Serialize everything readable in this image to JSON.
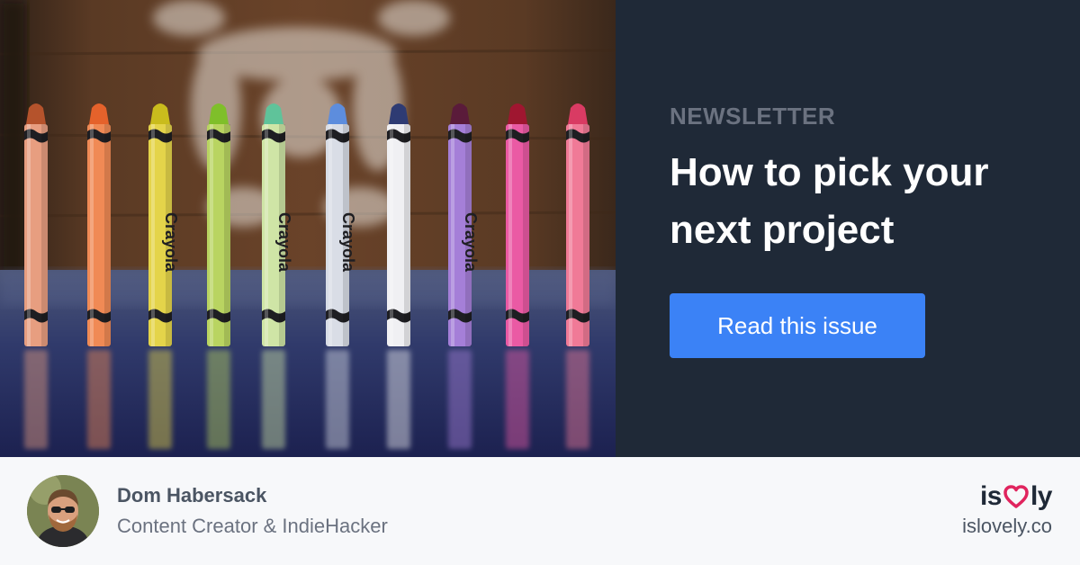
{
  "hero": {
    "eyebrow": "NEWSLETTER",
    "headline": "How to pick your next project",
    "cta_label": "Read this issue",
    "crayon_print": "Crayola"
  },
  "author": {
    "name": "Dom Habersack",
    "role": "Content Creator & IndieHacker"
  },
  "brand": {
    "logo_left": "is",
    "logo_right": "ly",
    "url": "islovely.co"
  },
  "colors": {
    "panel_bg": "#1f2937",
    "eyebrow": "#6b7280",
    "cta_bg": "#3b82f6",
    "footer_bg": "#f7f8fa",
    "heart": "#e0245e"
  },
  "icons": {
    "logo_heart": "heart-icon"
  }
}
